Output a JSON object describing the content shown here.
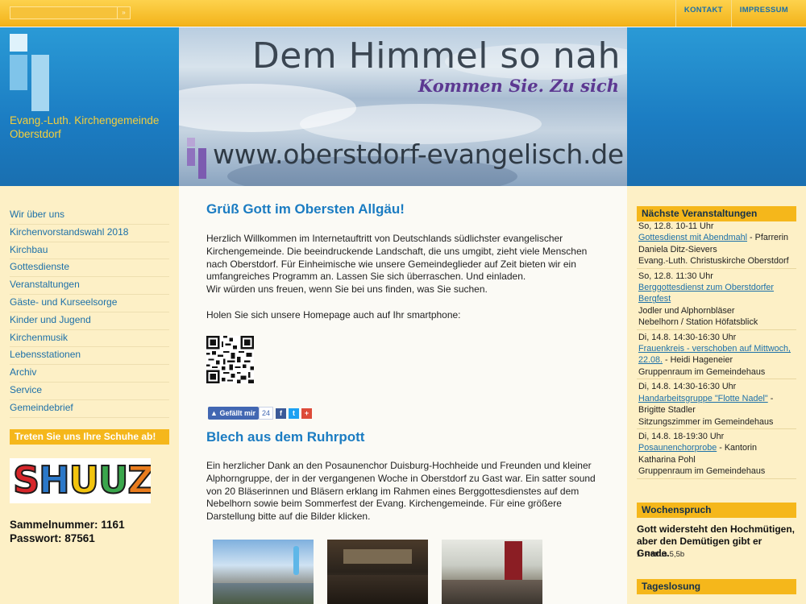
{
  "topbar": {
    "search": {
      "placeholder": "",
      "button_label": "»"
    },
    "links": [
      "KONTAKT",
      "IMPRESSUM"
    ]
  },
  "header": {
    "org_name": "Evang.-Luth. Kirchengemeinde Oberstdorf",
    "banner_title": "Dem Himmel so nah",
    "banner_subtitle": "Kommen Sie. Zu sich",
    "banner_url": "www.oberstdorf-evangelisch.de"
  },
  "nav": [
    "Wir über uns",
    "Kirchenvorstandswahl 2018",
    "Kirchbau",
    "Gottesdienste",
    "Veranstaltungen",
    "Gäste- und Kurseelsorge",
    "Kinder und Jugend",
    "Kirchenmusik",
    "Lebensstationen",
    "Archiv",
    "Service",
    "Gemeindebrief"
  ],
  "left_promo": {
    "heading": "Treten Sie uns Ihre Schuhe ab!",
    "logo_text": "SHUUZ",
    "collect_number": "Sammelnummer: 1161",
    "password": "Passwort: 87561"
  },
  "main": {
    "welcome_title": "Grüß Gott im Obersten Allgäu!",
    "welcome_text": "Herzlich Willkommen im Internetauftritt von Deutschlands südlichster evangelischer Kirchengemeinde. Die beeindruckende Landschaft, die uns umgibt, zieht viele Menschen nach Oberstdorf. Für Einheimische wie unsere Gemeindeglieder auf Zeit bieten wir ein umfangreiches Programm an. Lassen Sie sich überraschen. Und einladen.",
    "welcome_text2": "Wir würden uns freuen, wenn Sie bei uns finden, was Sie suchen.",
    "smartphone_text": "Holen Sie sich unsere Homepage auch auf Ihr smartphone:",
    "like_label": "Gefällt mir",
    "like_count": "24",
    "share_icons": [
      "f",
      "t",
      "+"
    ],
    "article_title": "Blech aus dem Ruhrpott",
    "article_text": "Ein herzlicher Dank an den Posaunenchor Duisburg-Hochheide und Freunden und kleiner Alphorngruppe, der in der vergangenen Woche in Oberstdorf zu Gast war. Ein satter sound von 20 Bläserinnen und Bläsern erklang im Rahmen eines Berggottesdienstes auf dem Nebelhorn sowie beim Sommerfest der Evang. Kirchengemeinde. Für eine größere Darstellung bitte auf die Bilder klicken."
  },
  "right": {
    "events_heading": "Nächste Veranstaltungen",
    "events": [
      {
        "date": "So, 12.8. 10-11 Uhr",
        "title": "Gottesdienst mit Abendmahl",
        "rest": " - Pfarrerin Daniela Ditz-Sievers",
        "place": "Evang.-Luth. Christuskirche Oberstdorf"
      },
      {
        "date": "So, 12.8. 11:30 Uhr",
        "title": "Berggottesdienst zum Oberstdorfer Bergfest",
        "rest": "",
        "place": "Jodler und Alphornbläser",
        "place2": "Nebelhorn / Station Höfatsblick"
      },
      {
        "date": "Di, 14.8. 14:30-16:30 Uhr",
        "title": "Frauenkreis - verschoben auf Mittwoch, 22.08.",
        "rest": " - Heidi Hageneier",
        "place": "Gruppenraum im Gemeindehaus"
      },
      {
        "date": "Di, 14.8. 14:30-16:30 Uhr",
        "title": "Handarbeitsgruppe \"Flotte Nadel\"",
        "rest": " - Brigitte Stadler",
        "place": "Sitzungszimmer im Gemeindehaus"
      },
      {
        "date": "Di, 14.8. 18-19:30 Uhr",
        "title": "Posaunenchorprobe",
        "rest": " - Kantorin Katharina Pohl",
        "place": "Gruppenraum im Gemeindehaus"
      }
    ],
    "weekly_heading": "Wochenspruch",
    "weekly_text": "Gott widersteht den Hochmütigen, aber den Demütigen gibt er Gnade.",
    "weekly_ref": "1. Petrus 5,5b",
    "daily_heading": "Tageslosung"
  },
  "colors": {
    "accent_blue": "#1b7cc2",
    "accent_yellow": "#f5b71b",
    "sidebar_bg": "#fdf0c6"
  }
}
